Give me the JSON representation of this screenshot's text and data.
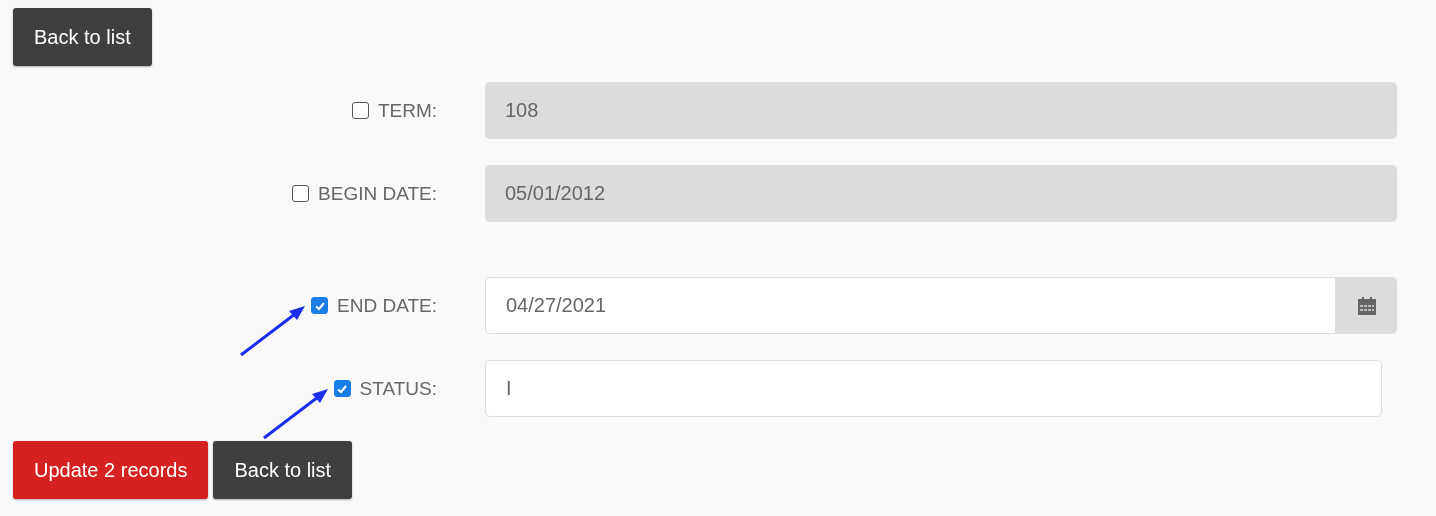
{
  "top_button": "Back to list",
  "field_groups": [
    [
      {
        "label": "TERM:",
        "checked": false,
        "kind": "disabled",
        "value": "108",
        "annotated": false
      },
      {
        "label": "BEGIN DATE:",
        "checked": false,
        "kind": "disabled",
        "value": "05/01/2012",
        "annotated": false
      }
    ],
    [
      {
        "label": "END DATE:",
        "checked": true,
        "kind": "date",
        "value": "04/27/2021",
        "annotated": true
      },
      {
        "label": "STATUS:",
        "checked": true,
        "kind": "text",
        "value": "I",
        "annotated": true
      }
    ]
  ],
  "actions": [
    {
      "label": "Update 2 records",
      "kind": "primary"
    },
    {
      "label": "Back to list",
      "kind": "secondary"
    }
  ]
}
